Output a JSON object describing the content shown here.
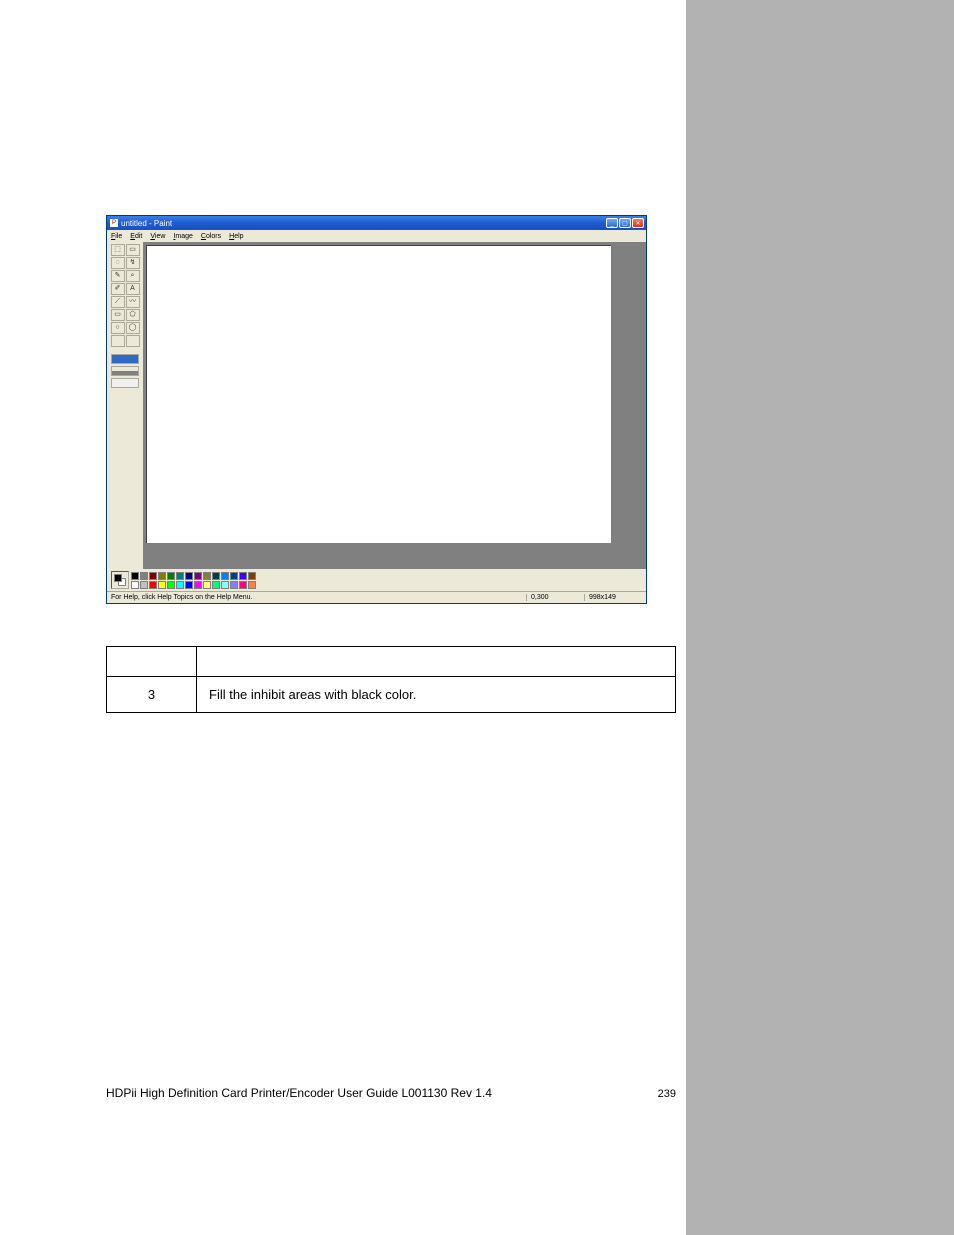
{
  "paint": {
    "title": "untitled - Paint",
    "menus": {
      "file": "File",
      "edit": "Edit",
      "view": "View",
      "image": "Image",
      "colors": "Colors",
      "help": "Help"
    },
    "tool_icons": [
      "⬚",
      "▭",
      "◌",
      "↯",
      "✎",
      "⌕",
      "✐",
      "A",
      "⟋",
      "〰",
      "▭",
      "⬠",
      "○",
      "◯",
      "",
      ""
    ],
    "palette_row1": [
      "#000000",
      "#808080",
      "#800000",
      "#808000",
      "#008000",
      "#008080",
      "#000080",
      "#800080",
      "#808040",
      "#004040",
      "#0080ff",
      "#004080",
      "#4000ff",
      "#804000"
    ],
    "palette_row2": [
      "#ffffff",
      "#c0c0c0",
      "#ff0000",
      "#ffff00",
      "#00ff00",
      "#00ffff",
      "#0000ff",
      "#ff00ff",
      "#ffff80",
      "#00ff80",
      "#80ffff",
      "#8080ff",
      "#ff0080",
      "#ff8040"
    ],
    "status": {
      "help": "For Help, click Help Topics on the Help Menu.",
      "pos": "0,300",
      "size": "998x149"
    }
  },
  "table": {
    "step": "3",
    "text": "Fill the inhibit areas with black color."
  },
  "footer": {
    "left": "HDPii High Definition Card Printer/Encoder User Guide    L001130 Rev 1.4",
    "page": "239"
  }
}
